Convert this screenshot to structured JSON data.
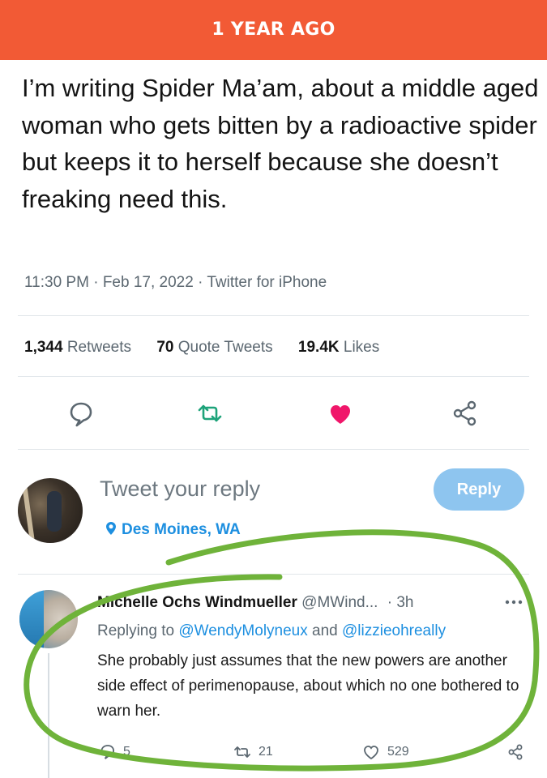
{
  "banner": {
    "label": "1 YEAR AGO"
  },
  "tweet": {
    "text": "I’m writing Spider Ma’am, about a middle aged woman who gets bitten by a radioactive spider but keeps it to herself because she doesn’t freaking need this.",
    "time": "11:30 PM",
    "date": "Feb 17, 2022",
    "source": "Twitter for iPhone",
    "separator": " · "
  },
  "stats": {
    "retweets_count": "1,344",
    "retweets_label": "Retweets",
    "quote_count": "70",
    "quote_label": "Quote Tweets",
    "likes_count": "19.4K",
    "likes_label": "Likes"
  },
  "actions": {
    "icons": [
      "comment-icon",
      "retweet-icon",
      "heart-icon",
      "share-icon"
    ],
    "heart_color": "#f0166a",
    "retweet_color": "#1ea37a"
  },
  "reply_box": {
    "placeholder": "Tweet your reply",
    "button_label": "Reply",
    "location": "Des Moines, WA",
    "button_color": "#8ec5ef"
  },
  "comment": {
    "name": "Michelle Ochs Windmueller",
    "handle": "@MWind...",
    "time": "3h",
    "replying_prefix": "Replying to",
    "mention_1": "@WendyMolyneux",
    "and": "and",
    "mention_2": "@lizzieohreally",
    "body": "She probably just assumes that the new powers are another side effect of perimenopause, about which no one bothered to warn her.",
    "replies": "5",
    "retweets": "21",
    "likes": "529"
  },
  "colors": {
    "banner": "#f25a35",
    "link": "#1d8fe0",
    "annotation_circle": "#6fb33a"
  }
}
